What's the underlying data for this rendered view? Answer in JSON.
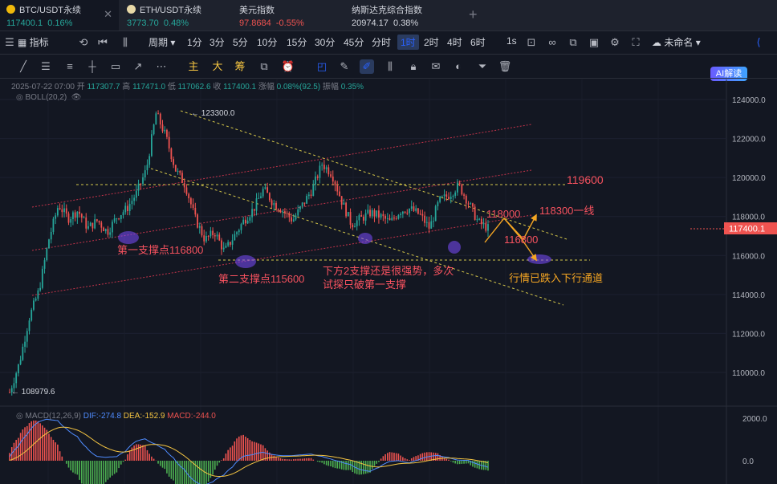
{
  "tabs": [
    {
      "name": "BTC/USDT永续",
      "price": "117400.1",
      "change": "0.16%"
    },
    {
      "name": "ETH/USDT永续",
      "price": "3773.70",
      "change": "0.48%"
    },
    {
      "name": "美元指数",
      "price": "97.8684",
      "change": "-0.55%"
    },
    {
      "name": "纳斯达克综合指数",
      "price": "20974.17",
      "change": "0.38%"
    }
  ],
  "toolbar": {
    "indicator": "指标",
    "period": "周期",
    "intervals": [
      "1分",
      "3分",
      "5分",
      "10分",
      "15分",
      "30分",
      "45分",
      "分时",
      "1时",
      "2时",
      "4时",
      "6时"
    ],
    "active_interval": "1时",
    "seconds": "1s",
    "unnamed": "未命名",
    "ai": "AI解读"
  },
  "draw_chars": [
    "主",
    "大",
    "筹"
  ],
  "info": {
    "date": "2025-07-22 07:00",
    "open_label": "开",
    "open": "117307.7",
    "high_label": "高",
    "high": "117471.0",
    "low_label": "低",
    "low": "117062.6",
    "close_label": "收",
    "close": "117400.1",
    "chg_label": "涨幅",
    "chg": "0.08%(92.5)",
    "amp_label": "振幅",
    "amp": "0.35%"
  },
  "boll_label": "BOLL(20,2)",
  "macd": {
    "label": "MACD(12,26,9)",
    "dif": "DIF:-274.8",
    "dea": "DEA:-152.9",
    "macd": "MACD:-244.0"
  },
  "price_axis": [
    "124000.0",
    "122000.0",
    "120000.0",
    "118000.0",
    "116000.0",
    "114000.0",
    "112000.0",
    "110000.0"
  ],
  "macd_axis": [
    "2000.0",
    "0.0"
  ],
  "current_price": "117400.1",
  "price_markers": {
    "high": "123300.0",
    "low": "108979.6"
  },
  "annotations": {
    "level_119600": "119600",
    "level_118000": "118000",
    "level_118300": "118300一线",
    "level_116800": "116800",
    "support1": "第一支撑点116800",
    "support2": "第二支撑点115600",
    "note_line1": "下方2支撑还是很强势，多次",
    "note_line2": "试探只破第一支撑",
    "downtrend": "行情已跌入下行通道"
  },
  "colors": {
    "up": "#26a69a",
    "down": "#ef5350",
    "bg": "#131722",
    "accent": "#2962ff",
    "annot": "#f7525f",
    "highlight": "#f5a623"
  },
  "chart_data": {
    "type": "candlestick",
    "ylim": [
      108500,
      124800
    ],
    "close_path": [
      108980,
      110500,
      112800,
      114200,
      116800,
      118600,
      117900,
      118300,
      117400,
      117800,
      117200,
      118000,
      118400,
      119200,
      120400,
      123300,
      122100,
      120400,
      119600,
      117900,
      116800,
      117200,
      116200,
      117000,
      117800,
      118400,
      119400,
      118700,
      118300,
      117800,
      118600,
      119400,
      120700,
      120200,
      118800,
      117600,
      117900,
      118200,
      118000,
      117700,
      118300,
      118400,
      118100,
      117400,
      118800,
      119100,
      119600,
      118700,
      117700,
      117400
    ],
    "boll": "20,2",
    "macd_params": "12,26,9"
  }
}
